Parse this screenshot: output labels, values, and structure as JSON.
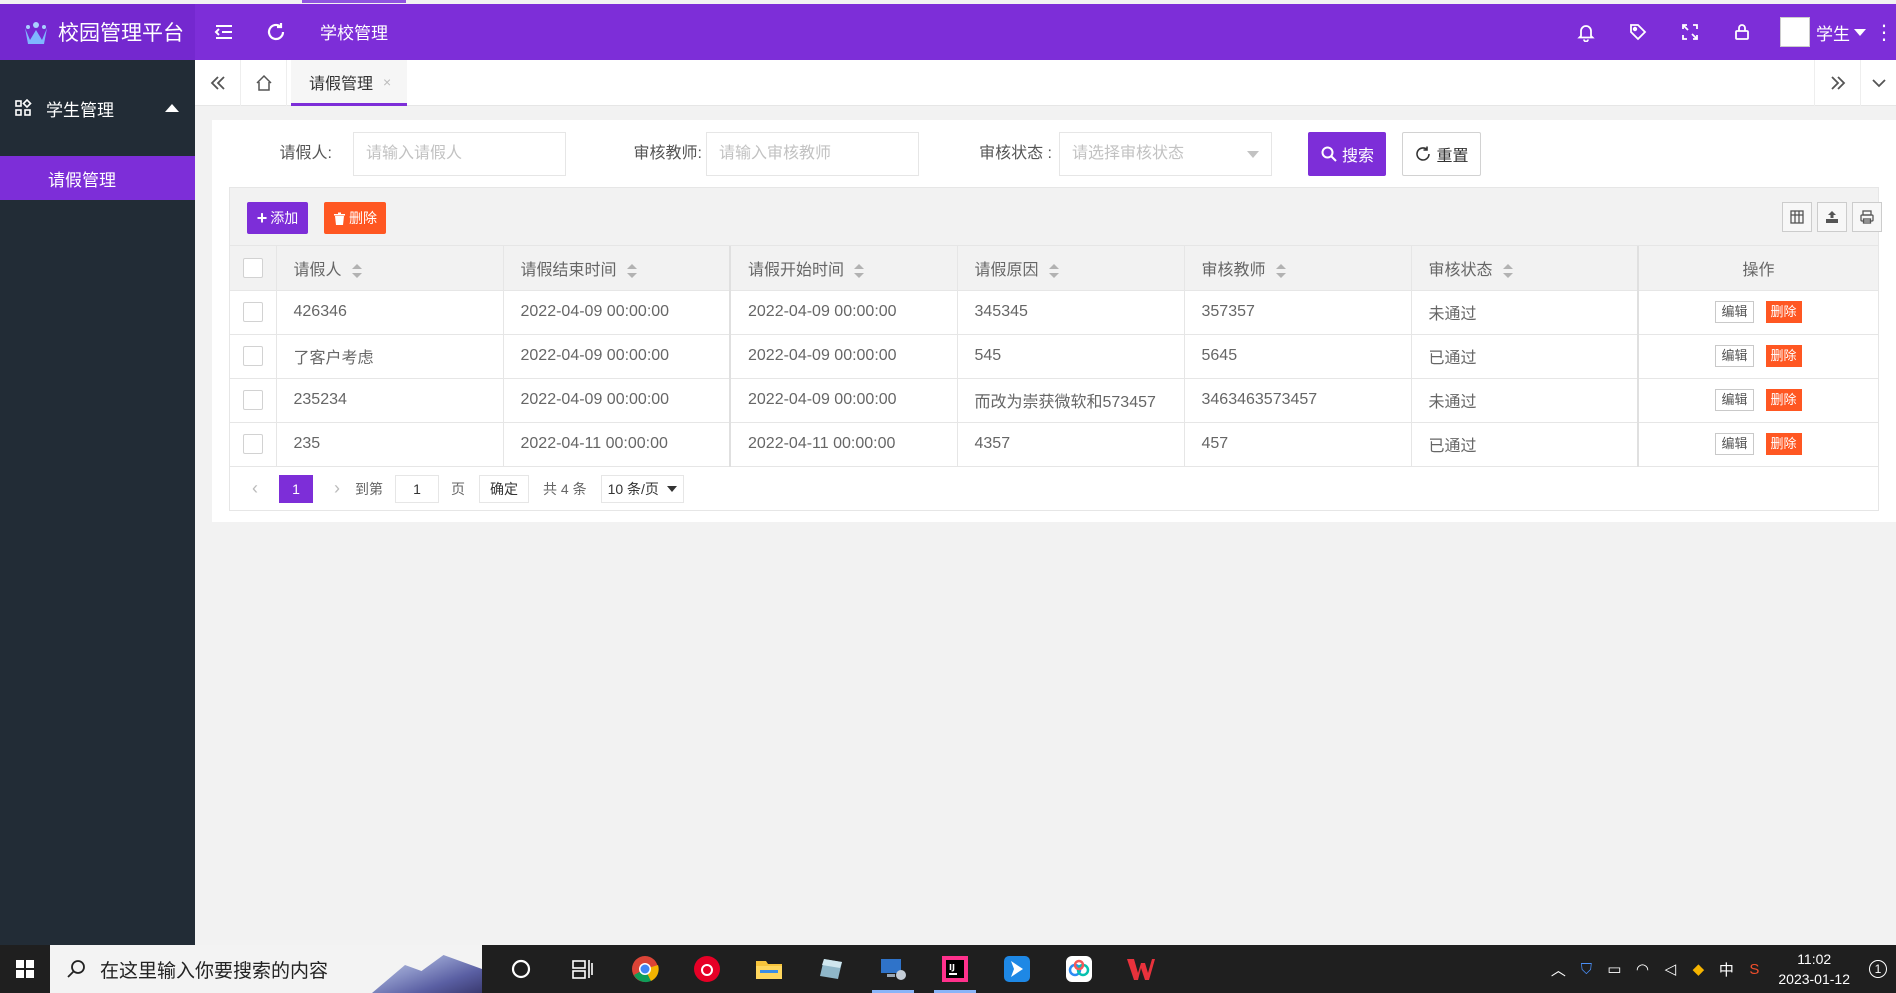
{
  "app": {
    "title": "校园管理平台",
    "accent": "#7d2ed8",
    "danger": "#ff5722"
  },
  "topbar": {
    "tab": "学校管理",
    "icons": [
      "menu-icon",
      "refresh-icon",
      "bell-icon",
      "tag-icon",
      "fullscreen-icon",
      "lock-icon"
    ],
    "user": "学生"
  },
  "sidebar": {
    "group": "学生管理",
    "items": [
      {
        "label": "请假管理",
        "active": true
      }
    ]
  },
  "tabs": [
    {
      "label": "请假管理",
      "close": "×"
    }
  ],
  "search": {
    "fields": [
      {
        "label": "请假人:",
        "placeholder": "请输入请假人"
      },
      {
        "label": "审核教师:",
        "placeholder": "请输入审核教师"
      },
      {
        "label": "审核状态 :",
        "placeholder": "请选择审核状态"
      }
    ],
    "search_label": "搜索",
    "reset_label": "重置"
  },
  "toolbar": {
    "add_label": "添加",
    "delete_label": "删除"
  },
  "table": {
    "columns": [
      "请假人",
      "请假结束时间",
      "请假开始时间",
      "请假原因",
      "审核教师",
      "审核状态",
      "操作"
    ],
    "rows": [
      [
        "426346",
        "2022-04-09 00:00:00",
        "2022-04-09 00:00:00",
        "345345",
        "357357",
        "未通过"
      ],
      [
        "了客户考虑",
        "2022-04-09 00:00:00",
        "2022-04-09 00:00:00",
        "545",
        "5645",
        "已通过"
      ],
      [
        "235234",
        "2022-04-09 00:00:00",
        "2022-04-09 00:00:00",
        "而改为崇获微软和573457",
        "3463463573457",
        "未通过"
      ],
      [
        "235",
        "2022-04-11 00:00:00",
        "2022-04-11 00:00:00",
        "4357",
        "457",
        "已通过"
      ]
    ],
    "edit_label": "编辑",
    "row_delete_label": "删除"
  },
  "pager": {
    "current": "1",
    "goto_label": "到第",
    "goto_value": "1",
    "page_unit": "页",
    "confirm": "确定",
    "total": "共 4 条",
    "page_size": "10 条/页"
  },
  "taskbar": {
    "search_placeholder": "在这里输入你要搜索的内容",
    "time": "11:02",
    "date": "2023-01-12",
    "ime": "中",
    "notifications": "1"
  }
}
